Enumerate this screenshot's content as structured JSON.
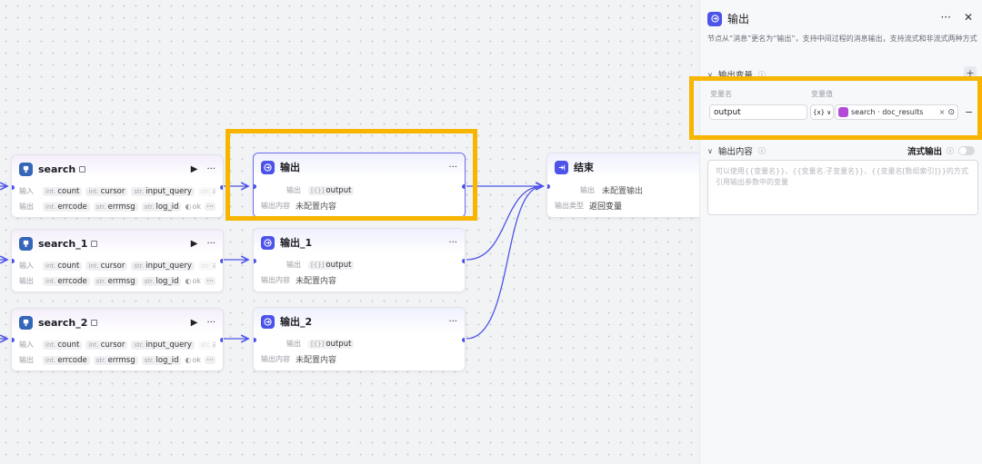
{
  "nodes": {
    "search": {
      "title": "search",
      "in_label": "输入",
      "out_label": "输出",
      "inputs": [
        {
          "t": "int",
          "n": "count"
        },
        {
          "t": "int",
          "n": "cursor"
        },
        {
          "t": "str",
          "n": "input_query"
        },
        {
          "t": "str",
          "n": "..."
        }
      ],
      "outputs": [
        {
          "t": "int",
          "n": "errcode"
        },
        {
          "t": "str",
          "n": "errmsg"
        },
        {
          "t": "str",
          "n": "log_id"
        }
      ],
      "ok": "ok",
      "more": "···"
    },
    "search_1": {
      "title": "search_1"
    },
    "search_2": {
      "title": "search_2"
    },
    "output": {
      "title": "输出",
      "out_label": "输出",
      "content_label": "输出内容",
      "var": "output",
      "content_value": "未配置内容"
    },
    "output_1": {
      "title": "输出_1"
    },
    "output_2": {
      "title": "输出_2"
    },
    "end": {
      "title": "结束",
      "out_label": "输出",
      "out_value": "未配置输出",
      "type_label": "输出类型",
      "type_value": "返回变量"
    }
  },
  "panel": {
    "title": "输出",
    "description": "节点从“消息”更名为“输出”，支持中间过程的消息输出，支持流式和非流式两种方式",
    "output_vars_label": "输出变量",
    "col_name": "变量名",
    "col_value": "变量值",
    "var_name": "output",
    "var_type_icon": "{x}",
    "ref_source": "search",
    "ref_field": "doc_results",
    "content_label": "输出内容",
    "stream_label": "流式输出",
    "placeholder": "可以使用{{变量名}}、{{变量名.子变量名}}、{{变量名[数组索引]}}的方式引用输出参数中的变量"
  },
  "colors": {
    "accent": "#4d53e8",
    "highlight": "#f7b500",
    "plugin": "#3566b8"
  }
}
